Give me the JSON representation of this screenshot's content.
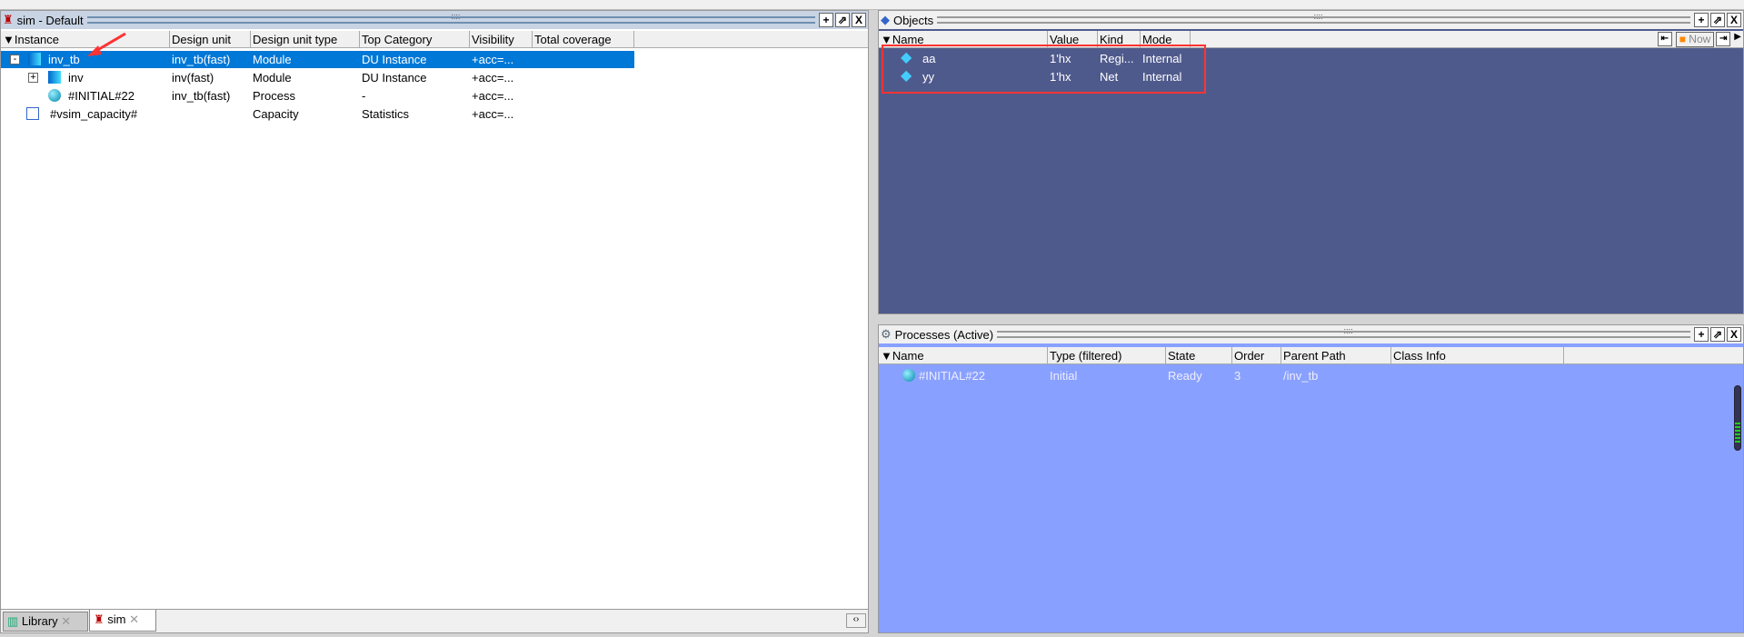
{
  "sim_panel": {
    "title": "sim - Default",
    "columns": [
      "Instance",
      "Design unit",
      "Design unit type",
      "Top Category",
      "Visibility",
      "Total coverage"
    ],
    "rows": [
      {
        "instance": "inv_tb",
        "design_unit": "inv_tb(fast)",
        "type": "Module",
        "category": "DU Instance",
        "visibility": "+acc=...",
        "coverage": "",
        "selected": true,
        "icon": "module-icon",
        "expander": "-"
      },
      {
        "instance": "inv",
        "design_unit": "inv(fast)",
        "type": "Module",
        "category": "DU Instance",
        "visibility": "+acc=...",
        "coverage": "",
        "icon": "module-icon",
        "expander": "+"
      },
      {
        "instance": "#INITIAL#22",
        "design_unit": "inv_tb(fast)",
        "type": "Process",
        "category": "-",
        "visibility": "+acc=...",
        "coverage": "",
        "icon": "process-icon"
      },
      {
        "instance": "#vsim_capacity#",
        "design_unit": "",
        "type": "Capacity",
        "category": "Statistics",
        "visibility": "+acc=...",
        "coverage": "",
        "icon": "capacity-icon"
      }
    ],
    "tabs": [
      {
        "label": "Library",
        "close": "✕"
      },
      {
        "label": "sim",
        "close": "✕",
        "active": true
      }
    ]
  },
  "objects_panel": {
    "title": "Objects",
    "columns": [
      "Name",
      "Value",
      "Kind",
      "Mode"
    ],
    "now_label": "Now",
    "rows": [
      {
        "name": "aa",
        "value": "1'hx",
        "kind": "Regi...",
        "mode": "Internal"
      },
      {
        "name": "yy",
        "value": "1'hx",
        "kind": "Net",
        "mode": "Internal"
      }
    ],
    "bg": "#4f5a8c"
  },
  "processes_panel": {
    "title": "Processes (Active)",
    "columns": [
      "Name",
      "Type (filtered)",
      "State",
      "Order",
      "Parent Path",
      "Class Info"
    ],
    "rows": [
      {
        "name": "#INITIAL#22",
        "type": "Initial",
        "state": "Ready",
        "order": "3",
        "parent": "/inv_tb",
        "class_info": ""
      }
    ],
    "bg": "#88a0ff"
  },
  "buttons": {
    "add": "+",
    "undock": "⇗",
    "close": "X"
  },
  "annotation_color": "#ff3333"
}
